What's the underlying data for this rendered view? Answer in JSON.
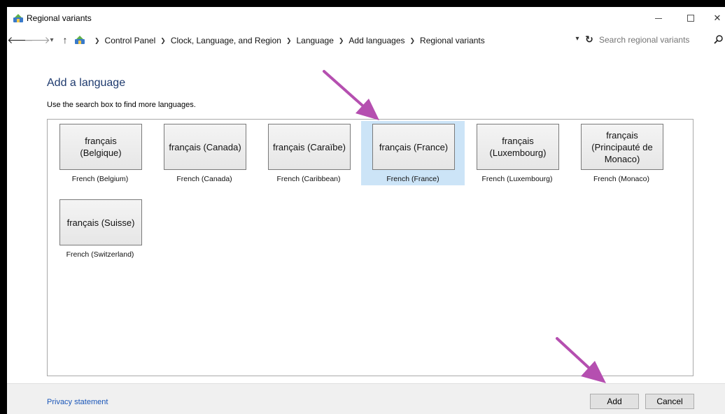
{
  "window": {
    "title": "Regional variants"
  },
  "address_bar": {
    "breadcrumbs": [
      "Control Panel",
      "Clock, Language, and Region",
      "Language",
      "Add languages",
      "Regional variants"
    ],
    "search_placeholder": "Search regional variants"
  },
  "content": {
    "heading": "Add a language",
    "subtext": "Use the search box to find more languages."
  },
  "languages": [
    {
      "native": "français (Belgique)",
      "english": "French (Belgium)",
      "selected": false
    },
    {
      "native": "français (Canada)",
      "english": "French (Canada)",
      "selected": false
    },
    {
      "native": "français (Caraïbe)",
      "english": "French (Caribbean)",
      "selected": false
    },
    {
      "native": "français (France)",
      "english": "French (France)",
      "selected": true
    },
    {
      "native": "français (Luxembourg)",
      "english": "French (Luxembourg)",
      "selected": false
    },
    {
      "native": "français (Principauté de Monaco)",
      "english": "French (Monaco)",
      "selected": false
    },
    {
      "native": "français (Suisse)",
      "english": "French (Switzerland)",
      "selected": false
    }
  ],
  "footer": {
    "privacy_label": "Privacy statement",
    "add_label": "Add",
    "cancel_label": "Cancel"
  },
  "colors": {
    "selection": "#cce4f7",
    "heading": "#1e3a6e",
    "link": "#1a56b8",
    "annotation_arrow": "#b54fb0"
  },
  "icons": {
    "app": "control-panel-icon",
    "back": "arrow-left-icon",
    "forward": "arrow-right-icon",
    "recent": "chevron-down-icon",
    "up": "arrow-up-icon",
    "refresh": "refresh-icon",
    "search": "search-icon"
  }
}
